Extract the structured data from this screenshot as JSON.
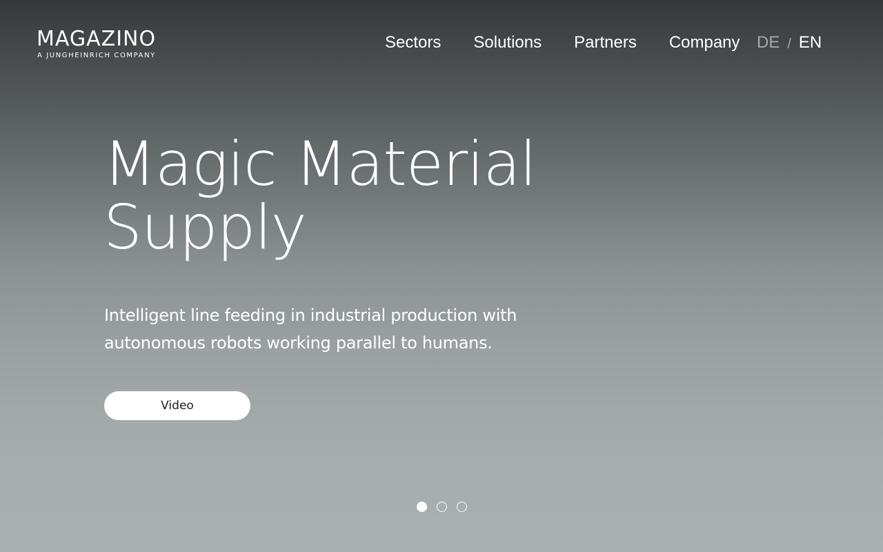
{
  "header": {
    "logo": {
      "name": "MAGAZINO",
      "tagline": "A JUNGHEINRICH COMPANY"
    },
    "nav": [
      {
        "label": "Sectors"
      },
      {
        "label": "Solutions"
      },
      {
        "label": "Partners"
      },
      {
        "label": "Company"
      }
    ],
    "language": {
      "options": [
        "DE",
        "EN"
      ],
      "separator": "/",
      "selected": "EN"
    }
  },
  "hero": {
    "title_line1": "Magic Material",
    "title_line2": "Supply",
    "subtitle": "Intelligent line feeding in industrial production with autonomous robots working parallel to humans.",
    "cta_label": "Video"
  },
  "carousel": {
    "slide_count": 3,
    "active_index": 0
  },
  "colors": {
    "background_top": "#373839",
    "background_bottom": "#aaafb0",
    "text": "#ffffff",
    "inactive_lang": "#a5a9ab",
    "button_bg": "#ffffff",
    "button_text": "#1d1d1d"
  }
}
